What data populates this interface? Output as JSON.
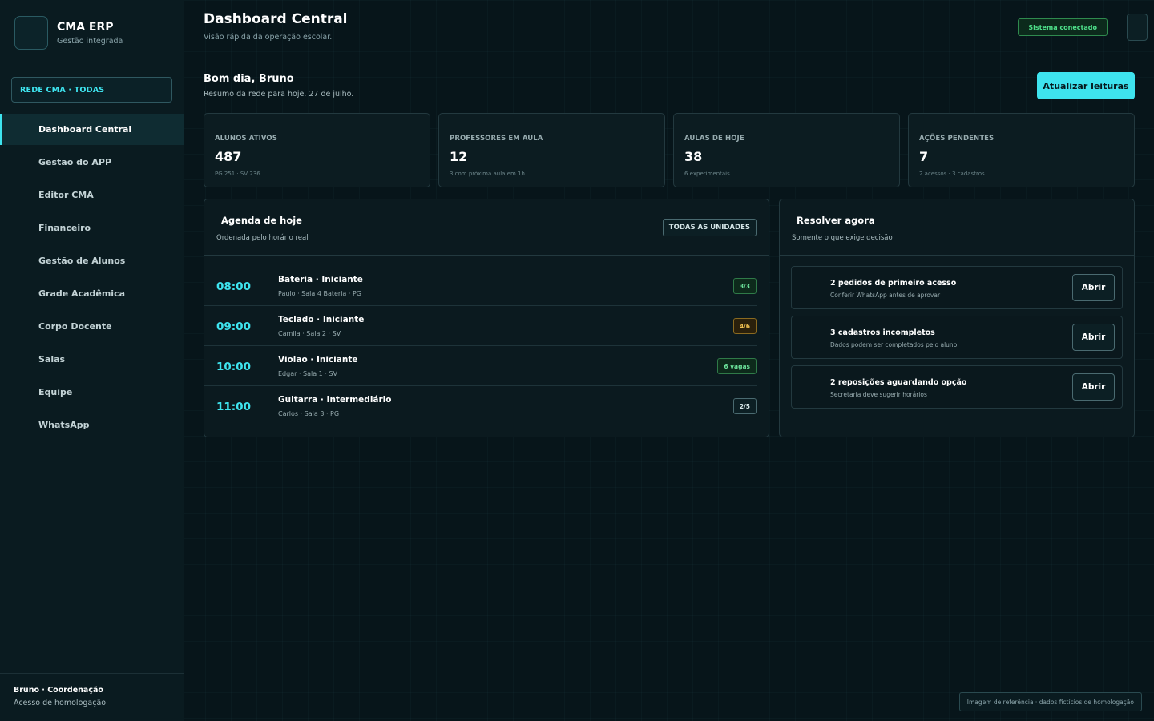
{
  "brand": {
    "title": "CMA ERP",
    "subtitle": "Gestão integrada"
  },
  "network_select": {
    "label": "REDE CMA · TODAS"
  },
  "sidebar": {
    "items": [
      {
        "label": "Dashboard Central",
        "active": true
      },
      {
        "label": "Gestão do APP"
      },
      {
        "label": "Editor CMA"
      },
      {
        "label": "Financeiro"
      },
      {
        "label": "Gestão de Alunos"
      },
      {
        "label": "Grade Acadêmica"
      },
      {
        "label": "Corpo Docente"
      },
      {
        "label": "Salas"
      },
      {
        "label": "Equipe"
      },
      {
        "label": "WhatsApp"
      }
    ],
    "footer": {
      "name": "Bruno · Coordenação",
      "role": "Acesso de homologação"
    }
  },
  "header": {
    "title": "Dashboard Central",
    "subtitle": "Visão rápida da operação escolar.",
    "status": "Sistema conectado"
  },
  "greeting": {
    "title": "Bom dia, Bruno",
    "subtitle": "Resumo da rede para hoje, 27 de julho.",
    "refresh_label": "Atualizar leituras"
  },
  "kpis": [
    {
      "label": "ALUNOS ATIVOS",
      "value": "487",
      "detail": "PG 251 · SV 236"
    },
    {
      "label": "PROFESSORES EM AULA",
      "value": "12",
      "detail": "3 com próxima aula em 1h"
    },
    {
      "label": "AULAS DE HOJE",
      "value": "38",
      "detail": "6 experimentais"
    },
    {
      "label": "AÇÕES PENDENTES",
      "value": "7",
      "detail": "2 acessos · 3 cadastros"
    }
  ],
  "agenda": {
    "title": "Agenda de hoje",
    "subtitle": "Ordenada pelo horário real",
    "filter_label": "TODAS AS UNIDADES",
    "rows": [
      {
        "time": "08:00",
        "name": "Bateria · Iniciante",
        "meta": "Paulo · Sala 4 Bateria · PG",
        "badge": "3/3",
        "badge_tone": "green"
      },
      {
        "time": "09:00",
        "name": "Teclado · Iniciante",
        "meta": "Camila · Sala 2 · SV",
        "badge": "4/6",
        "badge_tone": "amber"
      },
      {
        "time": "10:00",
        "name": "Violão · Iniciante",
        "meta": "Edgar · Sala 1 · SV",
        "badge": "6 vagas",
        "badge_tone": "green"
      },
      {
        "time": "11:00",
        "name": "Guitarra · Intermediário",
        "meta": "Carlos · Sala 3 · PG",
        "badge": "2/5",
        "badge_tone": "neutral"
      }
    ]
  },
  "resolve": {
    "title": "Resolver agora",
    "subtitle": "Somente o que exige decisão",
    "tasks": [
      {
        "title": "2 pedidos de primeiro acesso",
        "sub": "Conferir WhatsApp antes de aprovar",
        "action": "Abrir"
      },
      {
        "title": "3 cadastros incompletos",
        "sub": "Dados podem ser completados pelo aluno",
        "action": "Abrir"
      },
      {
        "title": "2 reposições aguardando opção",
        "sub": "Secretaria deve sugerir horários",
        "action": "Abrir"
      }
    ]
  },
  "reference_note": "Imagem de referência · dados fictícios de homologação",
  "colors": {
    "accent": "#3ee3ee",
    "background": "#07151a",
    "success": "#4ee08a",
    "warning": "#f0c050"
  }
}
